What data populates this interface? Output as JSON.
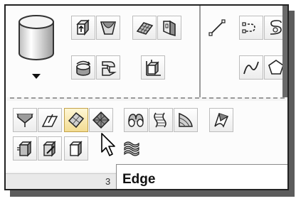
{
  "tooltip": {
    "text": "Edge"
  },
  "status_strip": {
    "label": "3"
  },
  "colors": {
    "highlight": "#f3dc92",
    "surface_fill": "#7f7f7f"
  },
  "icons": {
    "panel_top": [
      "cylinder-icon",
      "dropdown-arrow-icon",
      "box-extrude-icon",
      "wedge-surface-icon",
      "flat-grid-surface-icon",
      "fold-surface-icon",
      "revolve-icon",
      "sweep-icon",
      "ucs-box-icon"
    ],
    "panel_right": [
      "line-icon",
      "polyline-icon",
      "helix-icon",
      "spline-icon",
      "polygon-icon"
    ],
    "panel_bottom": [
      "planar-surface-icon",
      "offset-surface-icon",
      "edge-surface-icon",
      "mesh-surface-icon",
      "loft-icon",
      "ruled-surface-icon",
      "revolved-surface-icon",
      "patch-surface-icon",
      "smooth-object-icon",
      "edit-mesh-icon",
      "refine-mesh-icon",
      "stacked-layers-icon"
    ]
  }
}
